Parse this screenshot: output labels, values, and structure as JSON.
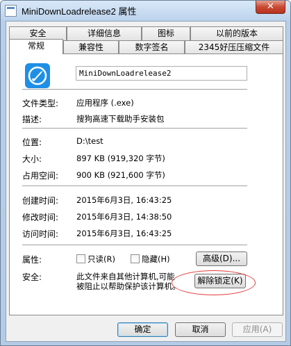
{
  "window": {
    "title": "MiniDownLoadrelease2 属性",
    "close_glyph": "✕"
  },
  "tabs_row1": [
    "安全",
    "详细信息",
    "图标",
    "以前的版本"
  ],
  "tabs_row2": [
    "常规",
    "兼容性",
    "数字签名",
    "2345好压压缩文件"
  ],
  "general": {
    "file_name": "MiniDownLoadrelease2",
    "type_label": "文件类型:",
    "type_value": "应用程序 (.exe)",
    "desc_label": "描述:",
    "desc_value": "搜狗高速下载助手安装包",
    "location_label": "位置:",
    "location_value": "D:\\test",
    "size_label": "大小:",
    "size_value": "897 KB (919,320 字节)",
    "disk_label": "占用空间:",
    "disk_value": "900 KB (921,600 字节)",
    "created_label": "创建时间:",
    "created_value": "2015年6月3日, 16:43:25",
    "modified_label": "修改时间:",
    "modified_value": "2015年6月3日, 14:38:50",
    "accessed_label": "访问时间:",
    "accessed_value": "2015年6月3日, 16:43:25",
    "attr_label": "属性:",
    "readonly_label": "只读(R)",
    "hidden_label": "隐藏(H)",
    "advanced_label": "高级(D)...",
    "security_label": "安全:",
    "security_text_1": "此文件来自其他计算机,可能",
    "security_text_2": "被阻止以帮助保护该计算机。",
    "unblock_label": "解除锁定(K)"
  },
  "footer": {
    "ok_label": "确定",
    "cancel_label": "取消",
    "apply_label": "应用(A)"
  },
  "colors": {
    "app_icon": "#1f8fe6",
    "annotation_oval": "#e23a3a"
  }
}
